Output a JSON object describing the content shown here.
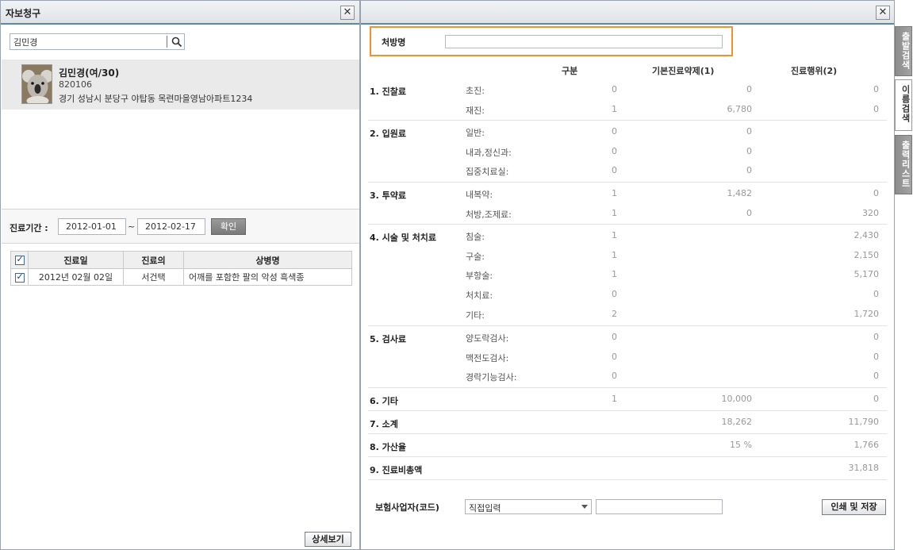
{
  "left": {
    "title": "자보청구",
    "search_value": "김민경",
    "patient": {
      "name": "김민경(여/30)",
      "id": "820106",
      "address": "경기 성남시 분당구 야탑동 목련마을영남아파트1234"
    },
    "period": {
      "label": "진료기간 :",
      "from": "2012-01-01",
      "tilde": "~",
      "to": "2012-02-17",
      "confirm": "확인"
    },
    "table": {
      "headers": [
        "진료일",
        "진료의",
        "상병명"
      ],
      "rows": [
        {
          "date": "2012년 02월 02일",
          "doctor": "서건택",
          "diagnosis": "어깨를 포함한 팔의 악성 흑색종"
        }
      ]
    },
    "detail_button": "상세보기"
  },
  "right": {
    "rx_label": "처방명",
    "columns": [
      "구분",
      "기본진료약제(1)",
      "진료행위(2)"
    ],
    "sections": [
      {
        "title": "1. 진찰료",
        "rows": [
          {
            "label": "초진:",
            "v1": "0",
            "v2": "0",
            "v3": "0"
          },
          {
            "label": "재진:",
            "v1": "1",
            "v2": "6,780",
            "v3": "0"
          }
        ]
      },
      {
        "title": "2. 입원료",
        "rows": [
          {
            "label": "일반:",
            "v1": "0",
            "v2": "0",
            "v3": ""
          },
          {
            "label": "내과,정신과:",
            "v1": "0",
            "v2": "0",
            "v3": ""
          },
          {
            "label": "집중치료실:",
            "v1": "0",
            "v2": "0",
            "v3": ""
          }
        ]
      },
      {
        "title": "3. 투약료",
        "rows": [
          {
            "label": "내복약:",
            "v1": "1",
            "v2": "1,482",
            "v3": "0"
          },
          {
            "label": "처방,조제료:",
            "v1": "1",
            "v2": "0",
            "v3": "320"
          }
        ]
      },
      {
        "title": "4. 시술 및 처치료",
        "rows": [
          {
            "label": "침술:",
            "v1": "1",
            "v2": "",
            "v3": "2,430"
          },
          {
            "label": "구술:",
            "v1": "1",
            "v2": "",
            "v3": "2,150"
          },
          {
            "label": "부항술:",
            "v1": "1",
            "v2": "",
            "v3": "5,170"
          },
          {
            "label": "처치료:",
            "v1": "0",
            "v2": "",
            "v3": "0"
          },
          {
            "label": "기타:",
            "v1": "2",
            "v2": "",
            "v3": "1,720"
          }
        ]
      },
      {
        "title": "5. 검사료",
        "rows": [
          {
            "label": "양도락검사:",
            "v1": "0",
            "v2": "",
            "v3": "0"
          },
          {
            "label": "맥전도검사:",
            "v1": "0",
            "v2": "",
            "v3": "0"
          },
          {
            "label": "경락기능검사:",
            "v1": "0",
            "v2": "",
            "v3": "0"
          }
        ]
      },
      {
        "title": "6. 기타",
        "rows": [
          {
            "label": "",
            "v1": "1",
            "v2": "10,000",
            "v3": "0"
          }
        ]
      },
      {
        "title": "7. 소계",
        "rows": [
          {
            "label": "",
            "v1": "",
            "v2": "18,262",
            "v3": "11,790"
          }
        ]
      },
      {
        "title": "8. 가산율",
        "rows": [
          {
            "label": "",
            "v1": "",
            "v2": "15 %",
            "v3": "1,766"
          }
        ]
      },
      {
        "title": "9. 진료비총액",
        "rows": [
          {
            "label": "",
            "v1": "",
            "v2": "",
            "v3": "31,818"
          }
        ]
      }
    ],
    "insurer_label": "보험사업자(코드)",
    "insurer_select": "직접입력",
    "print_button": "인쇄 및 저장"
  },
  "side_tabs": [
    "출발검색",
    "이름검색",
    "출력리스트"
  ]
}
